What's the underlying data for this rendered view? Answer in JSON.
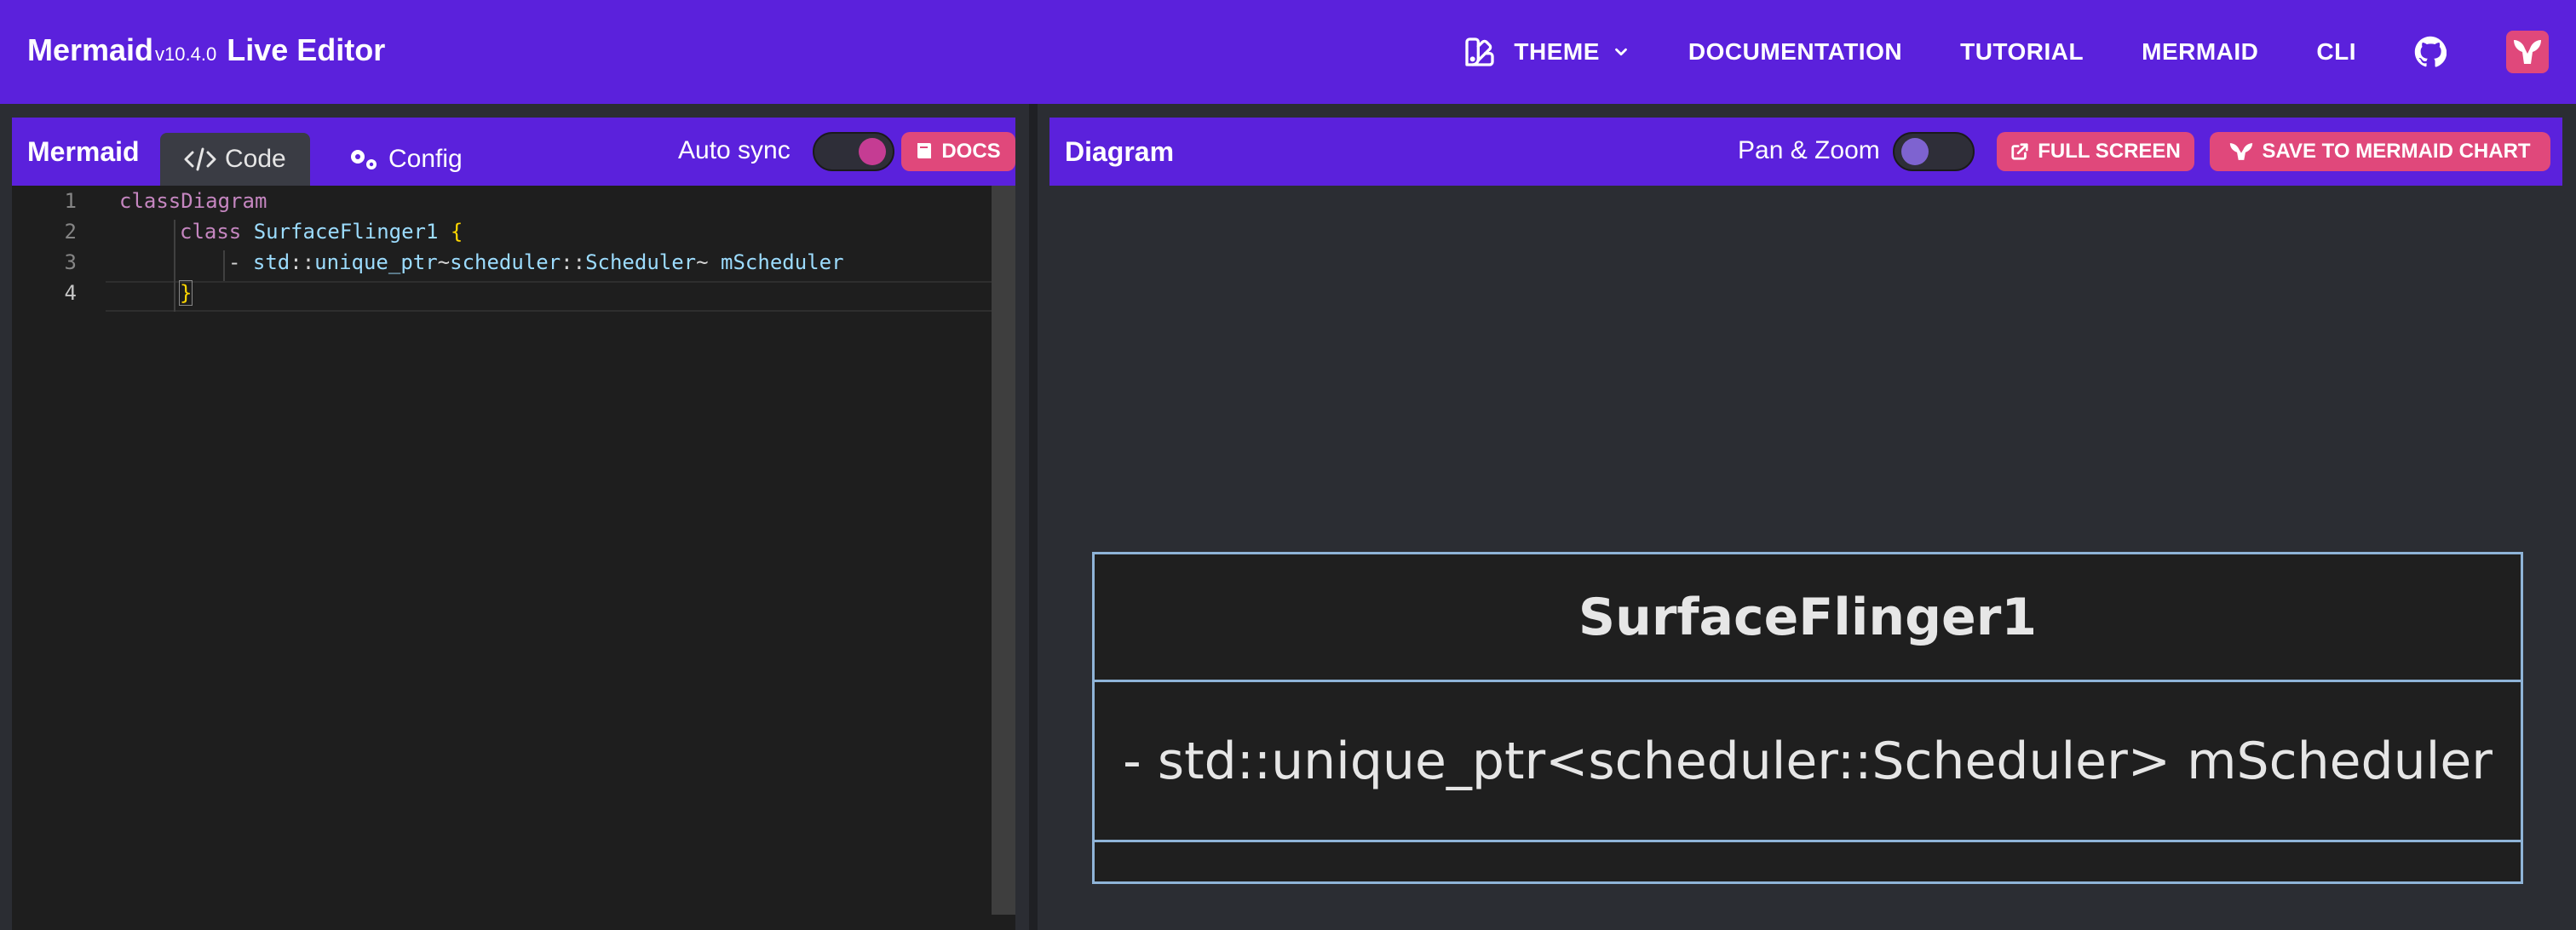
{
  "app": {
    "name": "Mermaid",
    "version": "v10.4.0",
    "title_suffix": "Live Editor"
  },
  "nav": {
    "theme": "THEME",
    "documentation": "DOCUMENTATION",
    "tutorial": "TUTORIAL",
    "mermaid": "MERMAID",
    "cli": "CLI"
  },
  "editor_panel": {
    "title": "Mermaid",
    "tabs": [
      {
        "label": "Code",
        "active": true
      },
      {
        "label": "Config",
        "active": false
      }
    ],
    "auto_sync_label": "Auto sync",
    "auto_sync_on": true,
    "docs_label": "DOCS"
  },
  "code": {
    "line_numbers": [
      "1",
      "2",
      "3",
      "4"
    ],
    "current_line": 4,
    "lines": {
      "l1_keyword": "classDiagram",
      "l2_keyword": "class",
      "l2_name": "SurfaceFlinger1",
      "l2_brace": "{",
      "l3_prefix": "- ",
      "l3_a": "std",
      "l3_sep1": "::",
      "l3_b": "unique_ptr",
      "l3_tilde1": "~",
      "l3_c": "scheduler",
      "l3_sep2": "::",
      "l3_d": "Scheduler",
      "l3_tilde2": "~",
      "l3_e": " mScheduler",
      "l4_brace": "}"
    }
  },
  "diagram_panel": {
    "title": "Diagram",
    "pan_zoom_label": "Pan & Zoom",
    "pan_zoom_on": false,
    "full_screen_label": "FULL SCREEN",
    "save_label": "SAVE TO MERMAID CHART"
  },
  "diagram": {
    "class_name": "SurfaceFlinger1",
    "member": "- std::unique_ptr<scheduler::Scheduler> mScheduler"
  },
  "colors": {
    "brand_purple": "#5b21dc",
    "accent_pink": "#e0487b",
    "editor_bg": "#1e1e1e",
    "diagram_bg": "#2b2d33",
    "uml_border": "#8fb4d8"
  },
  "icons": [
    "theme-icon",
    "chevron-down-icon",
    "github-icon",
    "mermaid-chart-logo-icon",
    "code-icon",
    "gears-icon",
    "book-icon",
    "external-link-icon",
    "mermaid-chart-icon"
  ]
}
